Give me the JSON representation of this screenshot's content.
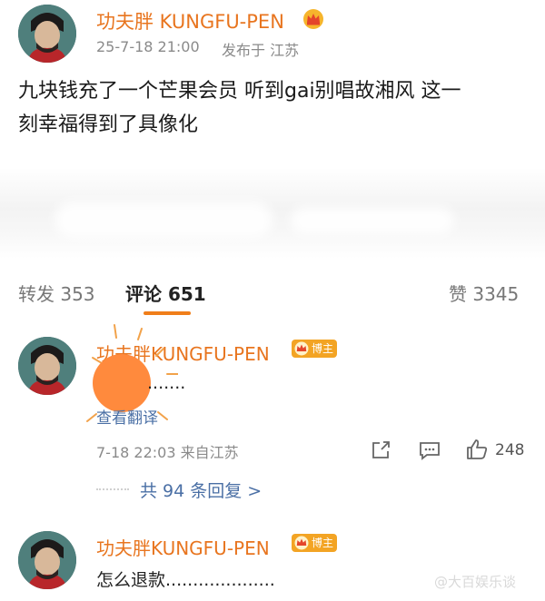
{
  "post": {
    "author": "功夫胖 KUNGFU-PEN",
    "time": "25-7-18 21:00",
    "location": "发布于 江苏",
    "text_line1": "九块钱充了一个芒果会员 听到gai别唱故湘风 这一",
    "text_line2": "刻幸福得到了具像化"
  },
  "tabs": {
    "repost": "转发 353",
    "comments": "评论 651",
    "likes": "赞 3345"
  },
  "comments": [
    {
      "author": "功夫胖KUNGFU-PEN",
      "badge": "博主",
      "text": ".......",
      "translate": "查看翻译",
      "time": "7-18 22:03 来自江苏",
      "like_count": "248",
      "replies": "共 94 条回复 >"
    },
    {
      "author": "功夫胖KUNGFU-PEN",
      "badge": "博主",
      "text": "怎么退款...................."
    }
  ],
  "watermark": "@大百娱乐谈",
  "colors": {
    "name": "#e8751f",
    "badge": "#f3a424",
    "tab_underline": "#f07e1a",
    "emoji_circle": "#ff8a3d",
    "link": "#4a6fa5"
  },
  "icons": [
    "crown-icon",
    "share-icon",
    "comment-icon",
    "like-icon",
    "emoji-sticker"
  ]
}
